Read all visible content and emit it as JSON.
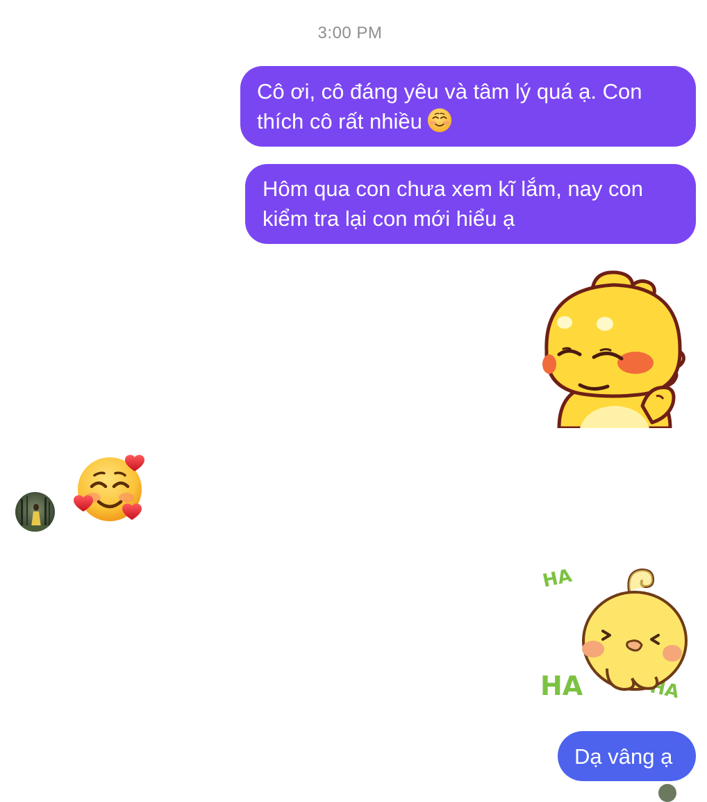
{
  "conversation": {
    "timestamp": "3:00 PM",
    "messages": [
      {
        "sender": "me",
        "type": "text",
        "lines": [
          "Cô ơi, cô đáng yêu và tâm lý quá ạ. Con",
          "thích cô rất nhiều"
        ],
        "trailing_emoji": "smiling-face-icon"
      },
      {
        "sender": "me",
        "type": "text",
        "lines": [
          "Hôm qua con chưa xem kĩ lắm, nay con",
          "kiểm tra lại con mới hiểu ạ"
        ]
      },
      {
        "sender": "me",
        "type": "sticker",
        "sticker": "blushing-yellow-chick-sticker"
      },
      {
        "sender": "other",
        "type": "emoji",
        "emoji": "smiling-face-with-hearts-icon"
      },
      {
        "sender": "me",
        "type": "sticker",
        "sticker": "laughing-chick-sticker",
        "sticker_text": [
          "HA",
          "HA",
          "HA"
        ]
      },
      {
        "sender": "me",
        "type": "text",
        "lines": [
          "Dạ vâng ạ"
        ]
      }
    ]
  },
  "colors": {
    "bubble_primary": "#7a46f2",
    "bubble_last": "#4d63ee",
    "timestamp": "#8e8e93",
    "sticker_ha_green": "#7cc242"
  }
}
